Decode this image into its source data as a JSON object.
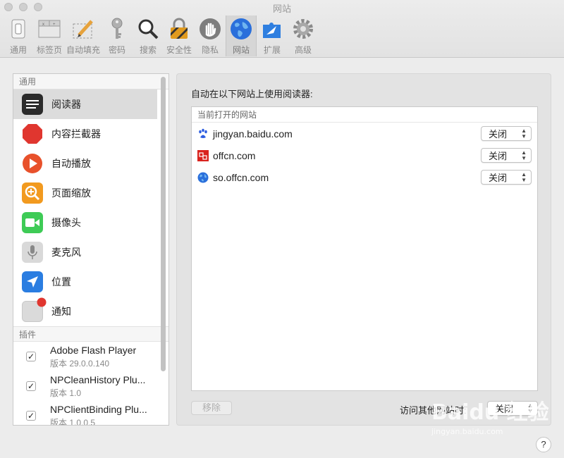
{
  "window": {
    "title": "网站"
  },
  "toolbar": {
    "items": [
      {
        "label": "通用",
        "icon": "switch-icon"
      },
      {
        "label": "标签页",
        "icon": "tabs-icon"
      },
      {
        "label": "自动填充",
        "icon": "pencil-icon"
      },
      {
        "label": "密码",
        "icon": "key-icon"
      },
      {
        "label": "搜索",
        "icon": "magnifier-icon"
      },
      {
        "label": "安全性",
        "icon": "lock-icon"
      },
      {
        "label": "隐私",
        "icon": "hand-icon"
      },
      {
        "label": "网站",
        "icon": "globe-icon"
      },
      {
        "label": "扩展",
        "icon": "puzzle-icon"
      },
      {
        "label": "高级",
        "icon": "gear-icon"
      }
    ],
    "active": "网站"
  },
  "sidebar": {
    "general_header": "通用",
    "items": [
      {
        "label": "阅读器",
        "icon": "reader-icon"
      },
      {
        "label": "内容拦截器",
        "icon": "stop-icon"
      },
      {
        "label": "自动播放",
        "icon": "play-icon"
      },
      {
        "label": "页面缩放",
        "icon": "zoom-icon"
      },
      {
        "label": "摄像头",
        "icon": "camera-icon"
      },
      {
        "label": "麦克风",
        "icon": "microphone-icon"
      },
      {
        "label": "位置",
        "icon": "location-icon"
      },
      {
        "label": "通知",
        "icon": "notification-icon"
      }
    ],
    "plugins_header": "插件",
    "plugins": [
      {
        "name": "Adobe Flash Player",
        "version": "版本 29.0.0.140",
        "checked": "✓"
      },
      {
        "name": "NPCleanHistory Plu...",
        "version": "版本 1.0",
        "checked": "✓"
      },
      {
        "name": "NPClientBinding Plu...",
        "version": "版本 1.0.0.5",
        "checked": "✓"
      }
    ]
  },
  "main": {
    "title": "自动在以下网站上使用阅读器:",
    "list_header": "当前打开的网站",
    "sites": [
      {
        "name": "jingyan.baidu.com",
        "setting": "关闭"
      },
      {
        "name": "offcn.com",
        "setting": "关闭"
      },
      {
        "name": "so.offcn.com",
        "setting": "关闭"
      }
    ],
    "remove_label": "移除",
    "other_sites_label": "访问其他网站时:",
    "other_sites_value": "关闭"
  },
  "watermark": {
    "main": "Baidu 经验",
    "sub": "jingyan.baidu.com"
  },
  "help_label": "?",
  "colors": {
    "accent": "#2a6fdb",
    "selected_row": "#dcdcdc",
    "stop_red": "#e0362f",
    "play_orange": "#e8512b",
    "camera_green": "#3ecb56"
  }
}
